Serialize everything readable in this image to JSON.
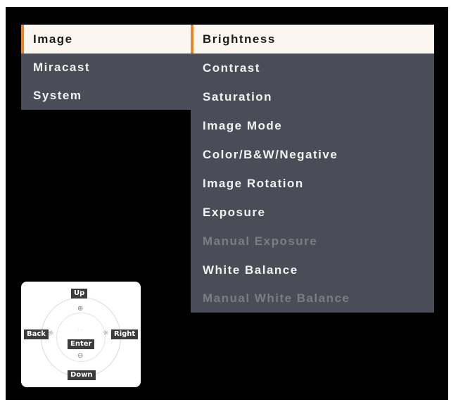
{
  "left_menu": {
    "items": [
      {
        "label": "Image",
        "selected": true
      },
      {
        "label": "Miracast",
        "selected": false
      },
      {
        "label": "System",
        "selected": false
      }
    ]
  },
  "submenu": {
    "items": [
      {
        "label": "Brightness",
        "state": "selected"
      },
      {
        "label": "Contrast",
        "state": "normal"
      },
      {
        "label": "Saturation",
        "state": "normal"
      },
      {
        "label": "Image Mode",
        "state": "normal"
      },
      {
        "label": "Color/B&W/Negative",
        "state": "normal"
      },
      {
        "label": "Image Rotation",
        "state": "normal"
      },
      {
        "label": "Exposure",
        "state": "normal"
      },
      {
        "label": "Manual Exposure",
        "state": "disabled"
      },
      {
        "label": "White Balance",
        "state": "normal"
      },
      {
        "label": "Manual White Balance",
        "state": "disabled"
      }
    ]
  },
  "legend": {
    "up": "Up",
    "down": "Down",
    "back": "Back",
    "right": "Right",
    "enter": "Enter"
  },
  "colors": {
    "accent": "#e8852a",
    "panel": "#4a4d57",
    "selected_bg": "#fbf6f0",
    "disabled_text": "#7b7d85"
  },
  "icons": [
    "zoom-in-icon",
    "zoom-out-icon",
    "brightness-low-icon",
    "brightness-high-icon"
  ]
}
